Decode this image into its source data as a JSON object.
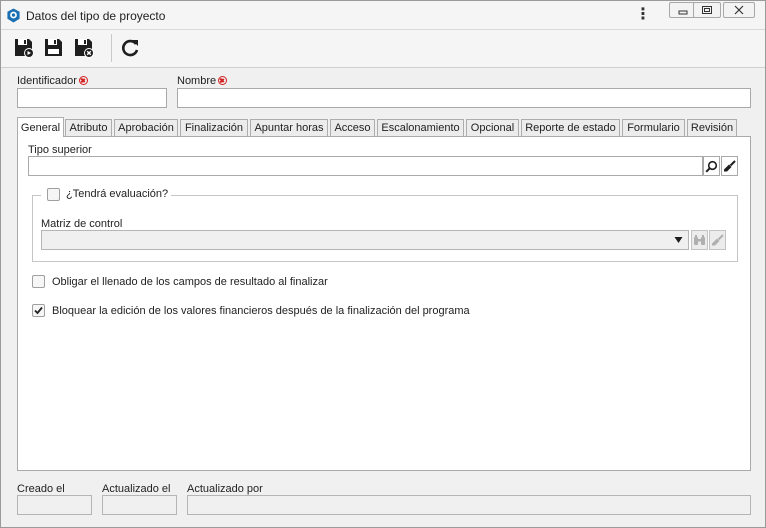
{
  "window": {
    "title": "Datos del tipo de proyecto",
    "menu_glyph": "⋮"
  },
  "toolbar": {
    "buttons": [
      {
        "name": "save-new-icon"
      },
      {
        "name": "save-icon"
      },
      {
        "name": "save-close-icon"
      },
      {
        "name": "refresh-icon"
      }
    ]
  },
  "form": {
    "identificador_label": "Identificador",
    "identificador_value": "",
    "nombre_label": "Nombre",
    "nombre_value": ""
  },
  "tabs": [
    {
      "label": "General",
      "active": true
    },
    {
      "label": "Atributo"
    },
    {
      "label": "Aprobación"
    },
    {
      "label": "Finalización"
    },
    {
      "label": "Apuntar horas"
    },
    {
      "label": "Acceso"
    },
    {
      "label": "Escalonamiento"
    },
    {
      "label": "Opcional"
    },
    {
      "label": "Reporte de estado"
    },
    {
      "label": "Formulario"
    },
    {
      "label": "Revisión"
    }
  ],
  "general": {
    "tipo_superior_label": "Tipo superior",
    "tipo_superior_value": "",
    "evaluacion_label": "¿Tendrá evaluación?",
    "evaluacion_checked": false,
    "matriz_label": "Matriz de control",
    "matriz_value": "",
    "obligar_label": "Obligar el llenado de los campos de resultado al finalizar",
    "obligar_checked": false,
    "bloquear_label": "Bloquear la edición de los valores financieros después de la finalización del programa",
    "bloquear_checked": true
  },
  "footer": {
    "creado_label": "Creado el",
    "actualizado_label": "Actualizado el",
    "actualizado_por_label": "Actualizado por"
  },
  "colors": {
    "accent": "#1b6fb3",
    "required": "#d42020"
  }
}
